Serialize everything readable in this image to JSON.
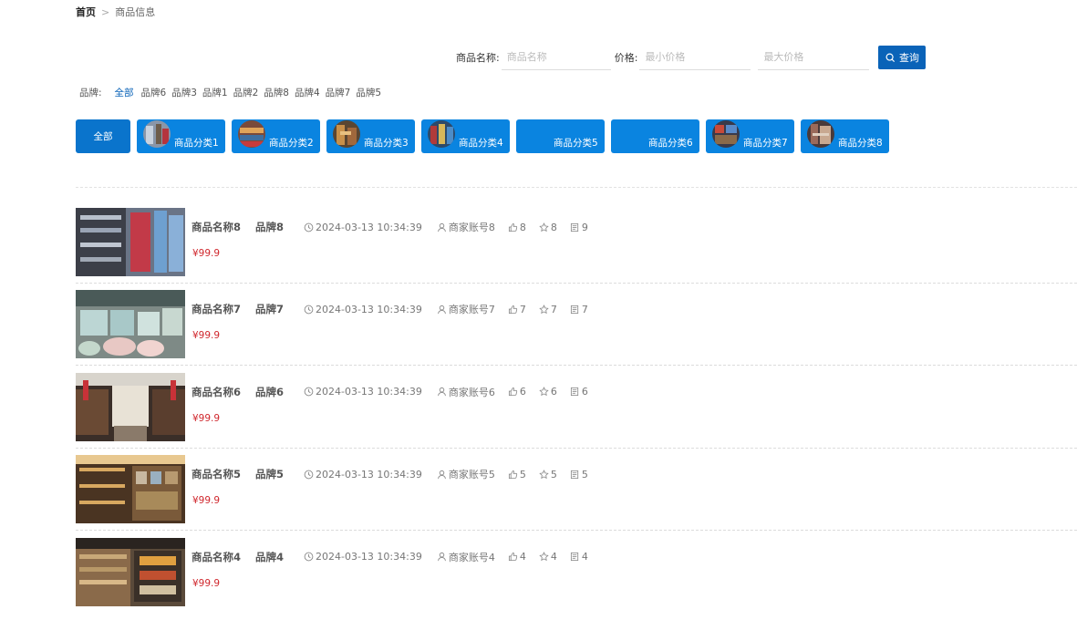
{
  "breadcrumb": {
    "home": "首页",
    "sep": ">",
    "current": "商品信息"
  },
  "search": {
    "name_label": "商品名称:",
    "name_placeholder": "商品名称",
    "price_label": "价格:",
    "min_placeholder": "最小价格",
    "max_placeholder": "最大价格",
    "button_label": "查询"
  },
  "brands": {
    "label": "品牌:",
    "items": [
      "全部",
      "品牌6",
      "品牌3",
      "品牌1",
      "品牌2",
      "品牌8",
      "品牌4",
      "品牌7",
      "品牌5"
    ]
  },
  "categories": {
    "all_label": "全部",
    "items": [
      "商品分类1",
      "商品分类2",
      "商品分类3",
      "商品分类4",
      "商品分类5",
      "商品分类6",
      "商品分类7",
      "商品分类8"
    ]
  },
  "products": [
    {
      "name": "商品名称8",
      "brand": "品牌8",
      "time": "2024-03-13 10:34:39",
      "merchant": "商家账号8",
      "likes": "8",
      "favorites": "8",
      "comments": "9",
      "price": "¥99.9"
    },
    {
      "name": "商品名称7",
      "brand": "品牌7",
      "time": "2024-03-13 10:34:39",
      "merchant": "商家账号7",
      "likes": "7",
      "favorites": "7",
      "comments": "7",
      "price": "¥99.9"
    },
    {
      "name": "商品名称6",
      "brand": "品牌6",
      "time": "2024-03-13 10:34:39",
      "merchant": "商家账号6",
      "likes": "6",
      "favorites": "6",
      "comments": "6",
      "price": "¥99.9"
    },
    {
      "name": "商品名称5",
      "brand": "品牌5",
      "time": "2024-03-13 10:34:39",
      "merchant": "商家账号5",
      "likes": "5",
      "favorites": "5",
      "comments": "5",
      "price": "¥99.9"
    },
    {
      "name": "商品名称4",
      "brand": "品牌4",
      "time": "2024-03-13 10:34:39",
      "merchant": "商家账号4",
      "likes": "4",
      "favorites": "4",
      "comments": "4",
      "price": "¥99.9"
    }
  ],
  "colors": {
    "primary": "#0a63b8",
    "category": "#0a84e0",
    "price": "#d0282e"
  }
}
